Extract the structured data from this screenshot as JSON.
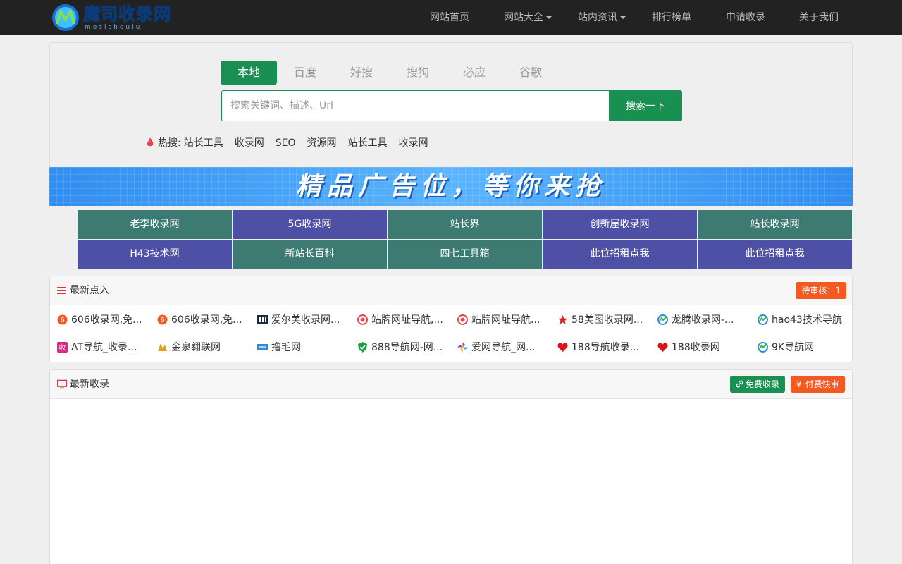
{
  "header": {
    "logo_text": "魔司收录网",
    "logo_sub": "mosishoulu",
    "nav": [
      {
        "label": "网站首页",
        "dropdown": false
      },
      {
        "label": "网站大全",
        "dropdown": true
      },
      {
        "label": "站内资讯",
        "dropdown": true
      },
      {
        "label": "排行榜单",
        "dropdown": false
      },
      {
        "label": "申请收录",
        "dropdown": false
      },
      {
        "label": "关于我们",
        "dropdown": false
      }
    ]
  },
  "search": {
    "tabs": [
      "本地",
      "百度",
      "好搜",
      "搜狗",
      "必应",
      "谷歌"
    ],
    "active_tab": "本地",
    "placeholder": "搜索关键词、描述、Url",
    "value": "",
    "button_label": "搜索一下",
    "hot_label": "热搜:",
    "hot_links": [
      "站长工具",
      "收录网",
      "SEO",
      "资源网",
      "站长工具",
      "收录网"
    ]
  },
  "banner": {
    "text": "精品广告位，等你来抢"
  },
  "friend_links": [
    {
      "label": "老李收录网",
      "color": "#3d7a72"
    },
    {
      "label": "5G收录网",
      "color": "#4e50a6"
    },
    {
      "label": "站长界",
      "color": "#3d7a72"
    },
    {
      "label": "创新屋收录网",
      "color": "#4e50a6"
    },
    {
      "label": "站长收录网",
      "color": "#3d7a72"
    },
    {
      "label": "H43技术网",
      "color": "#4e50a6"
    },
    {
      "label": "新站长百科",
      "color": "#3d7a72"
    },
    {
      "label": "四七工具箱",
      "color": "#3d7a72"
    },
    {
      "label": "此位招租点我",
      "color": "#4e50a6"
    },
    {
      "label": "此位招租点我",
      "color": "#4e50a6"
    }
  ],
  "latest_visits": {
    "title": "最新点入",
    "pending_badge": "待审核：1",
    "items": [
      {
        "label": "606收录网,免...",
        "icon": "orange-circle-6-icon"
      },
      {
        "label": "606收录网,免...",
        "icon": "orange-circle-6-icon"
      },
      {
        "label": "爱尔美收录网...",
        "icon": "dark-square-icon"
      },
      {
        "label": "站牌网址导航,...",
        "icon": "red-swirl-icon"
      },
      {
        "label": "站牌网址导航...",
        "icon": "red-swirl-icon"
      },
      {
        "label": "58美图收录网...",
        "icon": "red-star-icon"
      },
      {
        "label": "龙腾收录网-...",
        "icon": "green-blue-circle-icon"
      },
      {
        "label": "hao43技术导航",
        "icon": "green-blue-circle-icon"
      },
      {
        "label": "AT导航_收录...",
        "icon": "pink-square-icon"
      },
      {
        "label": "金泉翱联网",
        "icon": "gold-logo-icon"
      },
      {
        "label": "撸毛网",
        "icon": "blue-rect-icon"
      },
      {
        "label": "888导航网-网...",
        "icon": "green-shield-icon"
      },
      {
        "label": "爱网导航_网...",
        "icon": "pinwheel-icon"
      },
      {
        "label": "188导航收录...",
        "icon": "red-heart-icon"
      },
      {
        "label": "188收录网",
        "icon": "red-heart-icon"
      },
      {
        "label": "9K导航网",
        "icon": "green-blue-circle-icon"
      }
    ]
  },
  "latest_included": {
    "title": "最新收录",
    "free_button": "免费收录",
    "paid_button": "付费快审"
  },
  "colors": {
    "primary_green": "#1a8f52",
    "nav_bg": "#222222",
    "badge_orange": "#f25a22"
  }
}
